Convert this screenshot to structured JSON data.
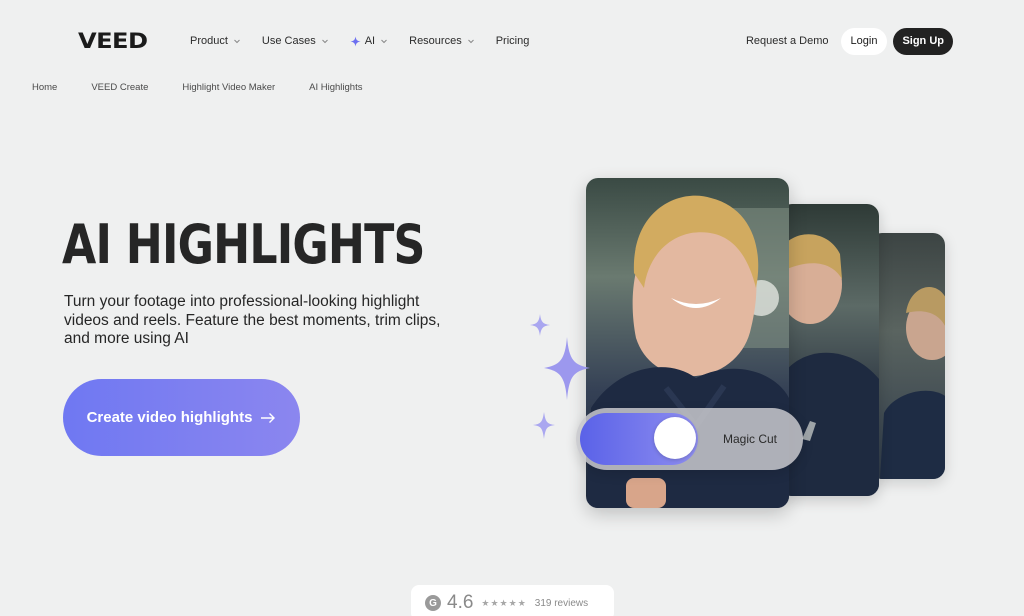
{
  "nav": {
    "logo": "VEED",
    "menu": [
      {
        "label": "Product",
        "has_dropdown": true
      },
      {
        "label": "Use Cases",
        "has_dropdown": true
      },
      {
        "label": "AI",
        "has_dropdown": true,
        "icon": "sparkle-icon"
      },
      {
        "label": "Resources",
        "has_dropdown": true
      },
      {
        "label": "Pricing",
        "has_dropdown": false
      }
    ],
    "request_demo": "Request a Demo",
    "login": "Login",
    "signup": "Sign Up"
  },
  "breadcrumb": [
    "Home",
    "VEED Create",
    "Highlight Video Maker",
    "AI Highlights"
  ],
  "hero": {
    "title": "AI HIGHLIGHTS",
    "subtitle": "Turn your footage into professional-looking highlight videos and reels. Feature the best moments, trim clips, and more using AI",
    "cta": "Create video highlights"
  },
  "visual": {
    "toggle_label": "Magic Cut",
    "toggle_on": true
  },
  "rating": {
    "badge": "G",
    "score": "4.6",
    "stars": 4.5,
    "reviews": "319 reviews"
  },
  "colors": {
    "background": "#eff0f0",
    "accent": "#6f78f2",
    "signup_bg": "#222222"
  }
}
